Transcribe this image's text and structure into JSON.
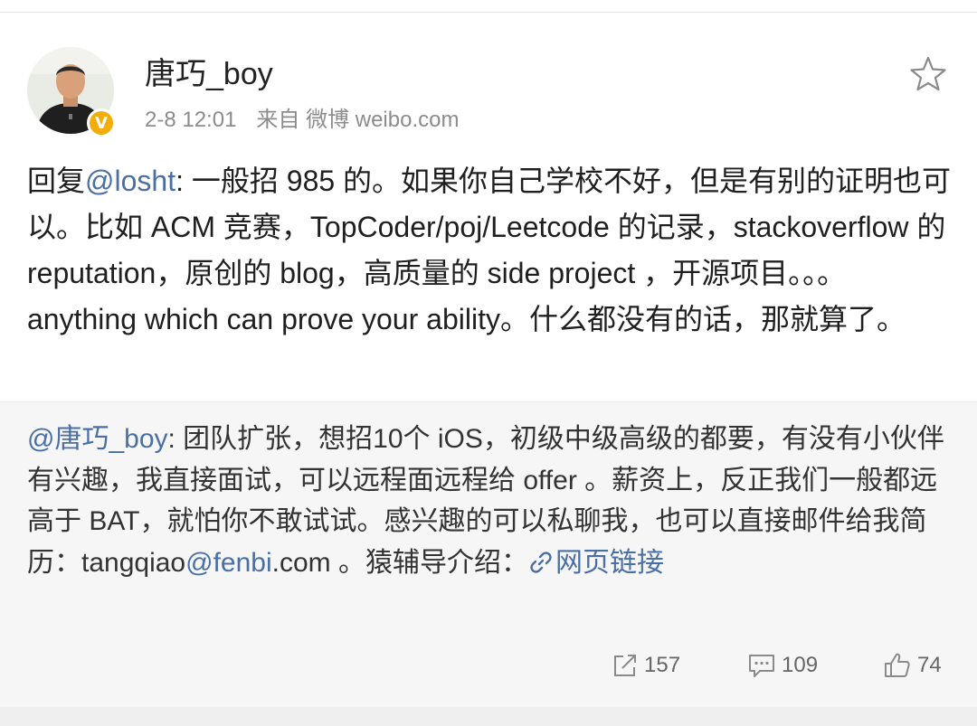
{
  "header": {
    "username": "唐巧_boy",
    "time": "2-8 12:01",
    "source": "来自 微博 weibo.com",
    "verified_badge": "V"
  },
  "post": {
    "prefix": "回复",
    "mention": "@losht",
    "text": ": 一般招 985 的。如果你自己学校不好，但是有别的证明也可以。比如 ACM 竞赛，TopCoder/poj/Leetcode 的记录，stackoverflow 的 reputation，原创的 blog，高质量的 side project ，开源项目。。。anything which can prove your ability。什么都没有的话，那就算了。"
  },
  "repost": {
    "mention": "@唐巧_boy",
    "text_before_email": ": 团队扩张，想招10个 iOS，初级中级高级的都要，有没有小伙伴有兴趣，我直接面试，可以远程面远程给 offer 。薪资上，反正我们一般都远高于 BAT，就怕你不敢试试。感兴趣的可以私聊我，也可以直接邮件给我简历：tangqiao",
    "email_mention": "@fenbi",
    "text_after_email": ".com 。猿辅导介绍：",
    "link_label": "网页链接"
  },
  "actions": {
    "repost_count": "157",
    "comment_count": "109",
    "like_count": "74"
  },
  "colors": {
    "link": "#4a6fa5",
    "badge": "#f3ad0b",
    "repost_bg": "#f6f6f6"
  },
  "icons": {
    "star": "star-icon",
    "repost": "repost-icon",
    "comment": "comment-icon",
    "like": "thumbs-up-icon",
    "link": "link-icon"
  }
}
